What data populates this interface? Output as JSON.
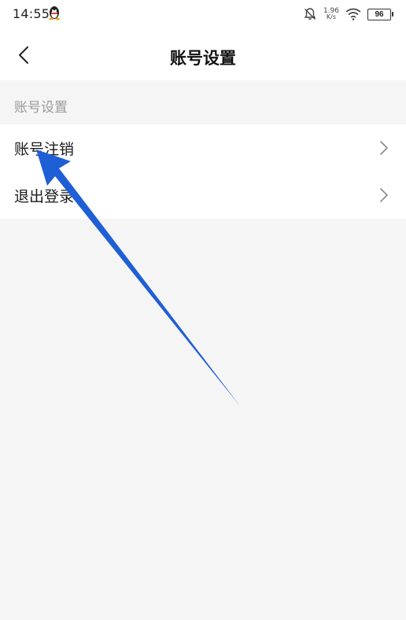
{
  "status_bar": {
    "time": "14:55",
    "net_speed_value": "1.96",
    "net_speed_unit": "K/s",
    "battery": "96"
  },
  "header": {
    "title": "账号设置"
  },
  "section": {
    "label": "账号设置"
  },
  "list": {
    "items": [
      {
        "label": "账号注销"
      },
      {
        "label": "退出登录"
      }
    ]
  },
  "annotation": {
    "arrow_color": "#1f5fd6"
  }
}
